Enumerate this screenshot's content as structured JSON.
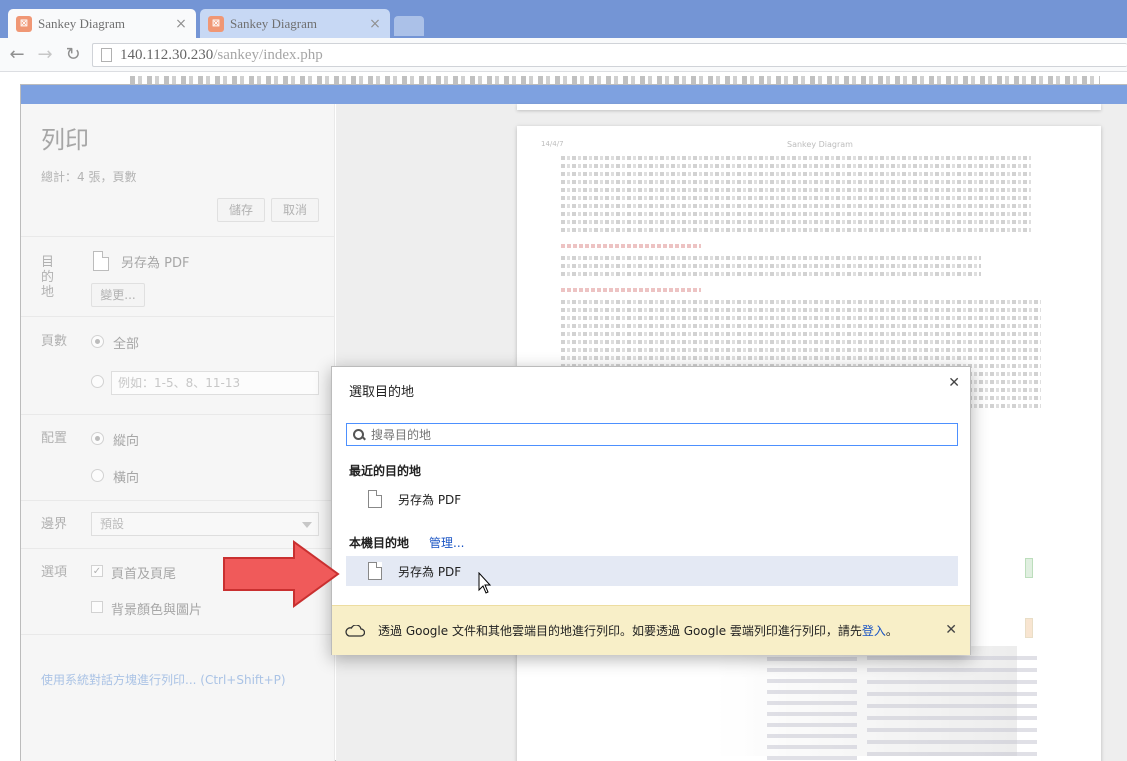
{
  "tabs": [
    {
      "title": "Sankey Diagram",
      "active": true
    },
    {
      "title": "Sankey Diagram",
      "active": false
    }
  ],
  "address": {
    "host": "140.112.30.230",
    "path": "/sankey/index.php"
  },
  "print": {
    "title": "列印",
    "total": "總計：4 張，頁數",
    "save_label": "儲存",
    "cancel_label": "取消",
    "destination_label": "目的地",
    "destination_value": "另存為 PDF",
    "change_label": "變更...",
    "pages_label": "頁數",
    "pages_all": "全部",
    "pages_placeholder": "例如：1-5、8、11-13",
    "layout_label": "配置",
    "layout_portrait": "縱向",
    "layout_landscape": "橫向",
    "margins_label": "邊界",
    "margins_value": "預設",
    "options_label": "選項",
    "option_header_footer": "頁首及頁尾",
    "option_background": "背景顏色與圖片",
    "system_dialog_link": "使用系統對話方塊進行列印... (Ctrl+Shift+P)"
  },
  "preview": {
    "date": "14/4/7",
    "title": "Sankey Diagram"
  },
  "destination_dialog": {
    "title": "選取目的地",
    "search_placeholder": "搜尋目的地",
    "recent_heading": "最近的目的地",
    "recent_item": "另存為 PDF",
    "local_heading": "本機目的地",
    "manage_label": "管理...",
    "local_item": "另存為 PDF",
    "cloud_message": "透過 Google 文件和其他雲端目的地進行列印。如要透過 Google 雲端列印進行列印，請先",
    "cloud_login": "登入",
    "cloud_suffix": "。"
  },
  "colors": {
    "accent": "#3a6fd0",
    "arrow": "#f05a5a",
    "cloud_bar": "#f8efc8",
    "selected_row": "#e4e9f4"
  },
  "icons": [
    "favicon-icon",
    "close-icon",
    "back-icon",
    "forward-icon",
    "reload-icon",
    "page-icon",
    "pdf-file-icon",
    "search-icon",
    "cloud-icon",
    "arrow-icon",
    "cursor-icon"
  ]
}
